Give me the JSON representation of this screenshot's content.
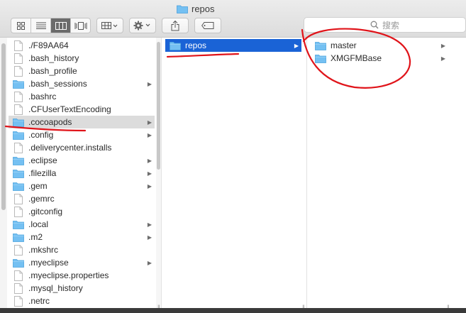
{
  "window": {
    "title": "repos",
    "title_icon": "folder-icon"
  },
  "toolbar": {
    "view_buttons": [
      "icon-view",
      "list-view",
      "column-view",
      "cover-flow-view"
    ],
    "active_view": "column-view",
    "arrange_icon": "arrange-grid-icon",
    "action_icon": "gear-icon",
    "share_icon": "share-icon",
    "tag_icon": "tag-icon",
    "search_placeholder": "搜索"
  },
  "column1": {
    "items": [
      {
        "label": "./F89AA64",
        "type": "file",
        "chevron": false
      },
      {
        "label": ".bash_history",
        "type": "file",
        "chevron": false
      },
      {
        "label": ".bash_profile",
        "type": "file",
        "chevron": false
      },
      {
        "label": ".bash_sessions",
        "type": "folder",
        "chevron": true
      },
      {
        "label": ".bashrc",
        "type": "file",
        "chevron": false
      },
      {
        "label": ".CFUserTextEncoding",
        "type": "file",
        "chevron": false
      },
      {
        "label": ".cocoapods",
        "type": "folder",
        "chevron": true,
        "selected": true
      },
      {
        "label": ".config",
        "type": "folder",
        "chevron": true
      },
      {
        "label": ".deliverycenter.installs",
        "type": "file",
        "chevron": false
      },
      {
        "label": ".eclipse",
        "type": "folder",
        "chevron": true
      },
      {
        "label": ".filezilla",
        "type": "folder",
        "chevron": true
      },
      {
        "label": ".gem",
        "type": "folder",
        "chevron": true
      },
      {
        "label": ".gemrc",
        "type": "file",
        "chevron": false
      },
      {
        "label": ".gitconfig",
        "type": "file",
        "chevron": false
      },
      {
        "label": ".local",
        "type": "folder",
        "chevron": true
      },
      {
        "label": ".m2",
        "type": "folder",
        "chevron": true
      },
      {
        "label": ".mkshrc",
        "type": "file",
        "chevron": false
      },
      {
        "label": ".myeclipse",
        "type": "folder",
        "chevron": true
      },
      {
        "label": ".myeclipse.properties",
        "type": "file",
        "chevron": false
      },
      {
        "label": ".mysql_history",
        "type": "file",
        "chevron": false
      },
      {
        "label": ".netrc",
        "type": "file",
        "chevron": false
      }
    ]
  },
  "column2": {
    "items": [
      {
        "label": "repos",
        "type": "folder",
        "chevron": true,
        "selected": true
      }
    ]
  },
  "column3": {
    "items": [
      {
        "label": "master",
        "type": "folder",
        "chevron": true
      },
      {
        "label": "XMGFMBase",
        "type": "folder",
        "chevron": true
      }
    ]
  },
  "colors": {
    "selection_blue": "#1a63d6",
    "selection_gray": "#dcdcdc",
    "folder_blue": "#62b7f0",
    "annotation_red": "#e0141a"
  }
}
